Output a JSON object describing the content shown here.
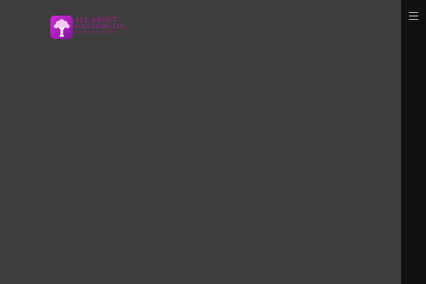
{
  "header": {
    "logo": {
      "line1": "ALL ABOUT",
      "line2": "SOLUTIONS LLC",
      "tagline": "EDUCATIONAL CONSULTANTS TRAINING",
      "icon": "tree-icon",
      "colors": {
        "icon_background": "#c020c8",
        "text": "#c516b7"
      }
    }
  },
  "sidebar": {
    "menu_icon": "hamburger-menu-icon",
    "background": "#111111"
  },
  "page": {
    "background": "#3d3d3d"
  }
}
